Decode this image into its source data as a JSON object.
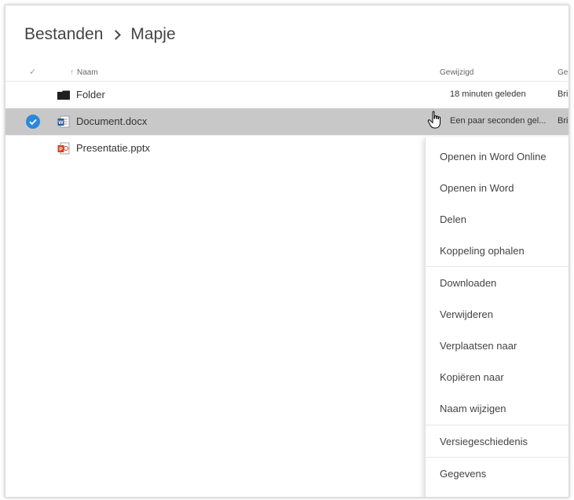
{
  "breadcrumb": {
    "root": "Bestanden",
    "current": "Mapje"
  },
  "columns": {
    "check": "✓",
    "sort_arrow": "↑",
    "name": "Naam",
    "modified": "Gewijzigd",
    "modified_by": "Ge"
  },
  "files": [
    {
      "name": "Folder",
      "modified": "18 minuten geleden",
      "modified_by": "Bri",
      "icon": "folder-icon",
      "selected": false
    },
    {
      "name": "Document.docx",
      "modified": "Een paar seconden gel...",
      "modified_by": "Bri",
      "icon": "word-file-icon",
      "selected": true
    },
    {
      "name": "Presentatie.pptx",
      "modified": "",
      "modified_by": "",
      "icon": "powerpoint-file-icon",
      "selected": false
    }
  ],
  "context_menu": {
    "items": [
      "Openen in Word Online",
      "Openen in Word",
      "Delen",
      "Koppeling ophalen",
      "Downloaden",
      "Verwijderen",
      "Verplaatsen naar",
      "Kopiëren naar",
      "Naam wijzigen",
      "Versiegeschiedenis",
      "Gegevens"
    ]
  },
  "colors": {
    "selection_row": "#c8c8c8",
    "selection_check": "#2b88d8",
    "word_blue": "#2b579a",
    "powerpoint_red": "#d24726"
  }
}
